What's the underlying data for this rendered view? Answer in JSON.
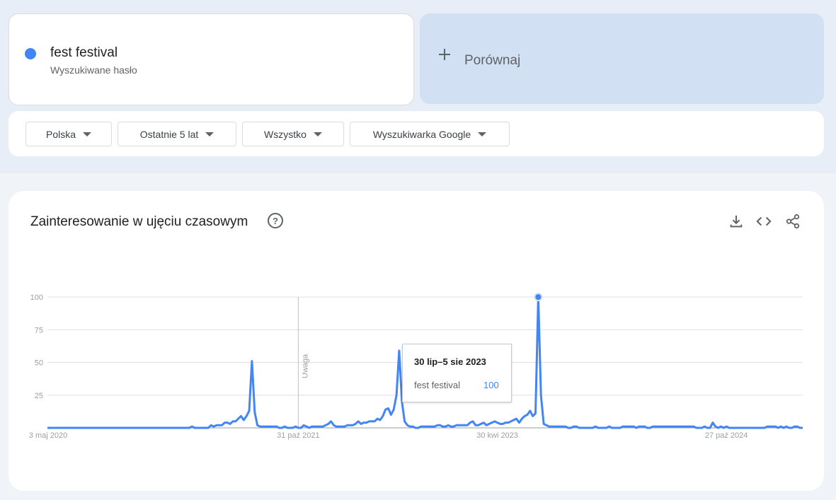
{
  "search_term": {
    "name": "fest festival",
    "type": "Wyszukiwane hasło",
    "color": "#4285f4"
  },
  "compare": {
    "icon": "plus-icon",
    "label": "Porównaj"
  },
  "filters": [
    {
      "label": "Polska"
    },
    {
      "label": "Ostatnie 5 lat"
    },
    {
      "label": "Wszystko"
    },
    {
      "label": "Wyszukiwarka Google"
    }
  ],
  "panel": {
    "title": "Zainteresowanie w ujęciu czasowym",
    "help_icon": "help-icon",
    "tools": [
      "download-icon",
      "embed-code-icon",
      "share-icon"
    ]
  },
  "tooltip": {
    "date": "30 lip–5 sie 2023",
    "term": "fest festival",
    "value": "100"
  },
  "chart_data": {
    "type": "line",
    "title": "",
    "xlabel": "",
    "ylabel": "",
    "ylim": [
      0,
      100
    ],
    "yticks": [
      "100",
      "75",
      "50",
      "25"
    ],
    "x_ticks": [
      "3 maj 2020",
      "31 paź 2021",
      "30 kwi 2023",
      "27 paź 2024"
    ],
    "annotation": "Uwaga",
    "grid": true,
    "series": [
      {
        "name": "fest festival",
        "color": "#4285f4",
        "values": [
          0,
          0,
          0,
          0,
          0,
          0,
          0,
          0,
          0,
          0,
          0,
          0,
          0,
          0,
          0,
          0,
          0,
          0,
          0,
          0,
          0,
          0,
          0,
          0,
          0,
          0,
          0,
          0,
          0,
          0,
          0,
          0,
          0,
          0,
          0,
          0,
          0,
          0,
          0,
          0,
          0,
          0,
          0,
          0,
          0,
          0,
          0,
          0,
          0,
          0,
          0,
          0,
          0,
          1,
          0,
          0,
          0,
          0,
          0,
          0,
          2,
          1,
          2,
          2,
          2,
          4,
          4,
          3,
          5,
          5,
          7,
          9,
          6,
          9,
          13,
          51,
          12,
          2,
          1,
          1,
          1,
          1,
          1,
          1,
          1,
          0,
          0,
          1,
          0,
          0,
          0,
          1,
          0,
          0,
          2,
          1,
          0,
          1,
          1,
          1,
          1,
          1,
          2,
          3,
          5,
          2,
          1,
          1,
          1,
          1,
          2,
          2,
          2,
          3,
          5,
          3,
          4,
          4,
          5,
          5,
          5,
          7,
          6,
          9,
          14,
          15,
          10,
          14,
          25,
          59,
          20,
          5,
          2,
          1,
          1,
          0,
          0,
          1,
          1,
          1,
          1,
          1,
          1,
          2,
          2,
          1,
          1,
          2,
          1,
          1,
          2,
          2,
          2,
          2,
          2,
          4,
          5,
          2,
          2,
          3,
          4,
          2,
          3,
          4,
          5,
          4,
          3,
          3,
          4,
          4,
          5,
          6,
          7,
          4,
          7,
          9,
          10,
          13,
          9,
          11,
          100,
          25,
          3,
          2,
          1,
          1,
          1,
          1,
          1,
          1,
          1,
          0,
          0,
          1,
          1,
          0,
          0,
          0,
          0,
          0,
          0,
          1,
          0,
          0,
          0,
          0,
          1,
          0,
          0,
          0,
          0,
          1,
          1,
          1,
          1,
          1,
          0,
          1,
          1,
          1,
          0,
          0,
          1,
          1,
          1,
          1,
          1,
          1,
          1,
          1,
          1,
          1,
          1,
          1,
          1,
          1,
          1,
          1,
          0,
          0,
          0,
          1,
          0,
          0,
          4,
          1,
          0,
          1,
          0,
          1,
          0,
          0,
          0,
          0,
          0,
          0,
          0,
          0,
          0,
          0,
          0,
          0,
          0,
          0,
          1,
          1,
          1,
          1,
          0,
          1,
          0,
          1,
          0,
          0,
          1,
          1,
          0,
          0
        ]
      }
    ]
  }
}
